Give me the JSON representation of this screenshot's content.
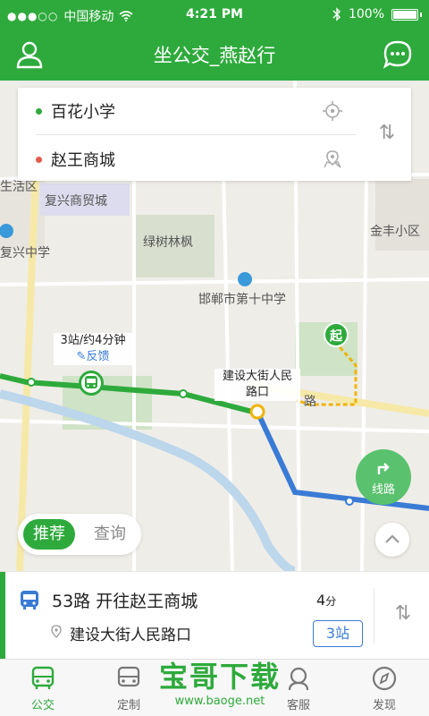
{
  "status_bar": {
    "signal": "●●●○○",
    "carrier": "中国移动",
    "time": "4:21 PM",
    "battery": "100%"
  },
  "header": {
    "title": "坐公交_燕赵行"
  },
  "search": {
    "origin": "百花小学",
    "destination": "赵王商城"
  },
  "map": {
    "labels": [
      "复兴商贸城",
      "绿树林枫",
      "金丰小区",
      "复兴中学",
      "邯郸市第十中学",
      "生活区"
    ],
    "route_info": "3站/约4分钟",
    "feedback": "反馈",
    "stop_callout_line1": "建设大街人民",
    "stop_callout_line2": "路口",
    "road_label": "路",
    "start_marker": "起",
    "route_button": "线路"
  },
  "toggle": {
    "recommend": "推荐",
    "query": "查询"
  },
  "result": {
    "line": "53路",
    "direction": "开往赵王商城",
    "minutes_value": "4",
    "minutes_unit": "分",
    "boarding_stop": "建设大街人民路口",
    "stations": "3站"
  },
  "tabs": [
    {
      "label": "公交",
      "active": true
    },
    {
      "label": "定制"
    },
    {
      "label": "客服"
    },
    {
      "label": "发现"
    }
  ],
  "watermark": {
    "text": "宝哥下载",
    "url": "www.baoge.net"
  },
  "colors": {
    "brand_green": "#2eaa3c",
    "route_blue": "#3a7bd5",
    "walk_yellow": "#f0b400"
  }
}
